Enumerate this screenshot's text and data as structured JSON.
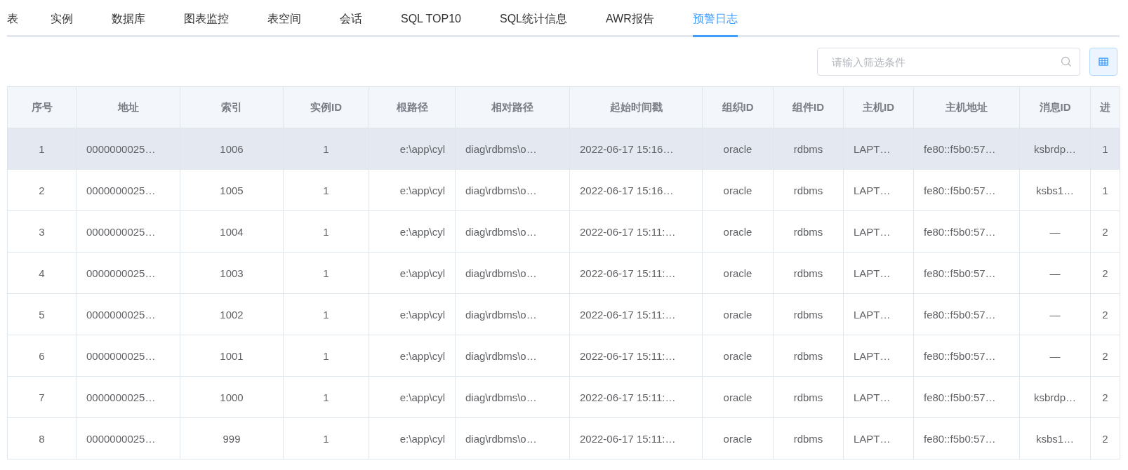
{
  "tabs": [
    {
      "label": "表",
      "selected": false
    },
    {
      "label": "实例",
      "selected": false
    },
    {
      "label": "数据库",
      "selected": false
    },
    {
      "label": "图表监控",
      "selected": false
    },
    {
      "label": "表空间",
      "selected": false
    },
    {
      "label": "会话",
      "selected": false
    },
    {
      "label": "SQL TOP10",
      "selected": false
    },
    {
      "label": "SQL统计信息",
      "selected": false
    },
    {
      "label": "AWR报告",
      "selected": false
    },
    {
      "label": "预警日志",
      "selected": true
    }
  ],
  "search": {
    "placeholder": "请输入筛选条件"
  },
  "table": {
    "columns": [
      "序号",
      "地址",
      "索引",
      "实例ID",
      "根路径",
      "相对路径",
      "起始时间戳",
      "组织ID",
      "组件ID",
      "主机ID",
      "主机地址",
      "消息ID",
      "进"
    ],
    "rows": [
      {
        "highlighted": true,
        "cells": [
          "1",
          "0000000025…",
          "1006",
          "1",
          "e:\\app\\cyl",
          "diag\\rdbms\\o…",
          "2022-06-17 15:16…",
          "oracle",
          "rdbms",
          "LAPT…",
          "fe80::f5b0:57…",
          "ksbrdp…",
          "1"
        ]
      },
      {
        "highlighted": false,
        "cells": [
          "2",
          "0000000025…",
          "1005",
          "1",
          "e:\\app\\cyl",
          "diag\\rdbms\\o…",
          "2022-06-17 15:16…",
          "oracle",
          "rdbms",
          "LAPT…",
          "fe80::f5b0:57…",
          "ksbs1…",
          "1"
        ]
      },
      {
        "highlighted": false,
        "cells": [
          "3",
          "0000000025…",
          "1004",
          "1",
          "e:\\app\\cyl",
          "diag\\rdbms\\o…",
          "2022-06-17 15:11:…",
          "oracle",
          "rdbms",
          "LAPT…",
          "fe80::f5b0:57…",
          "—",
          "2"
        ]
      },
      {
        "highlighted": false,
        "cells": [
          "4",
          "0000000025…",
          "1003",
          "1",
          "e:\\app\\cyl",
          "diag\\rdbms\\o…",
          "2022-06-17 15:11:…",
          "oracle",
          "rdbms",
          "LAPT…",
          "fe80::f5b0:57…",
          "—",
          "2"
        ]
      },
      {
        "highlighted": false,
        "cells": [
          "5",
          "0000000025…",
          "1002",
          "1",
          "e:\\app\\cyl",
          "diag\\rdbms\\o…",
          "2022-06-17 15:11:…",
          "oracle",
          "rdbms",
          "LAPT…",
          "fe80::f5b0:57…",
          "—",
          "2"
        ]
      },
      {
        "highlighted": false,
        "cells": [
          "6",
          "0000000025…",
          "1001",
          "1",
          "e:\\app\\cyl",
          "diag\\rdbms\\o…",
          "2022-06-17 15:11:…",
          "oracle",
          "rdbms",
          "LAPT…",
          "fe80::f5b0:57…",
          "—",
          "2"
        ]
      },
      {
        "highlighted": false,
        "cells": [
          "7",
          "0000000025…",
          "1000",
          "1",
          "e:\\app\\cyl",
          "diag\\rdbms\\o…",
          "2022-06-17 15:11:…",
          "oracle",
          "rdbms",
          "LAPT…",
          "fe80::f5b0:57…",
          "ksbrdp…",
          "2"
        ]
      },
      {
        "highlighted": false,
        "cells": [
          "8",
          "0000000025…",
          "999",
          "1",
          "e:\\app\\cyl",
          "diag\\rdbms\\o…",
          "2022-06-17 15:11:…",
          "oracle",
          "rdbms",
          "LAPT…",
          "fe80::f5b0:57…",
          "ksbs1…",
          "2"
        ]
      }
    ]
  }
}
